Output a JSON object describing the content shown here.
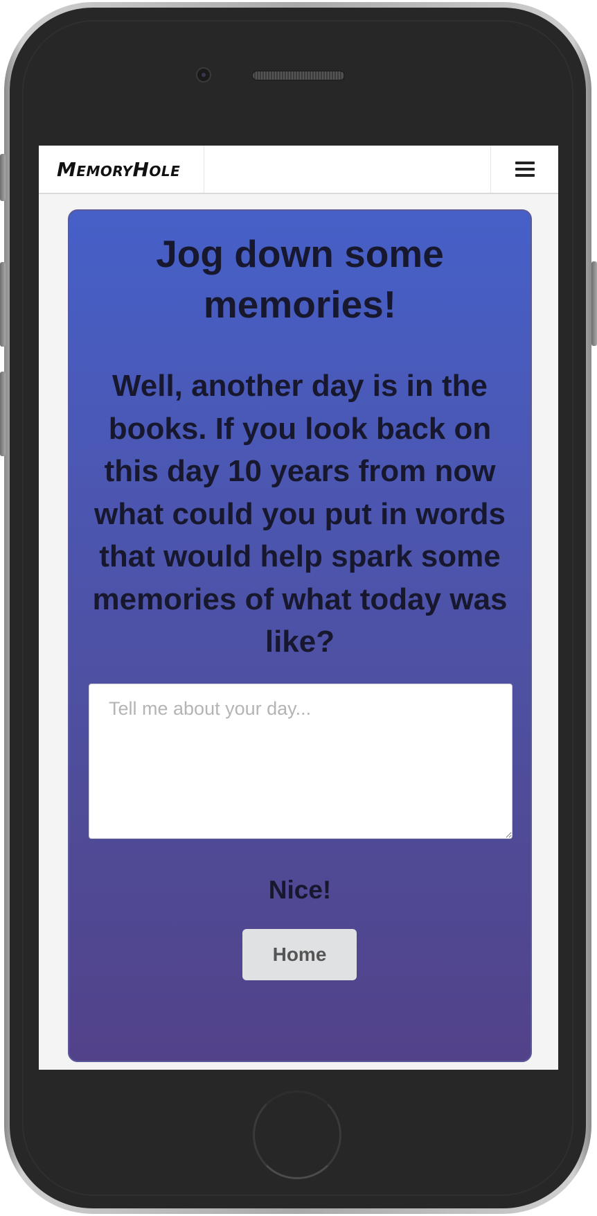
{
  "app": {
    "brand": "MemoryHole"
  },
  "navbar": {
    "menu_icon": "hamburger-menu-icon"
  },
  "card": {
    "title": "Jog down some memories!",
    "prompt": "Well, another day is in the books. If you look back on this day 10 years from now what could you put in words that would help spark some memories of what today was like?",
    "input": {
      "value": "",
      "placeholder": "Tell me about your day..."
    },
    "status_text": "Nice!",
    "home_button_label": "Home"
  },
  "colors": {
    "card_gradient_top": "#4660c8",
    "card_gradient_bottom": "#52428a",
    "screen_background": "#f4f4f5",
    "button_background": "#e0e1e2",
    "text_dark": "#17182e"
  }
}
